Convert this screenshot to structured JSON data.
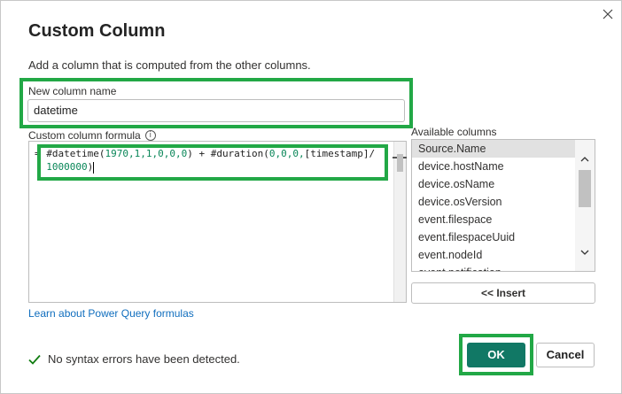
{
  "dialog": {
    "title": "Custom Column",
    "subtitle": "Add a column that is computed from the other columns."
  },
  "new_column": {
    "label": "New column name",
    "value": "datetime"
  },
  "formula": {
    "label": "Custom column formula",
    "prefix": "= ",
    "line1_a": "#datetime(",
    "line1_b": "1970,1,1,0,0,0",
    "line1_c": ") + #duration(",
    "line1_d": "0,0,0,",
    "line1_e": "[timestamp]/",
    "line2_a": "1000000",
    "line2_b": ")"
  },
  "available_columns": {
    "label": "Available columns",
    "items": [
      "Source.Name",
      "device.hostName",
      "device.osName",
      "device.osVersion",
      "event.filespace",
      "event.filespaceUuid",
      "event.nodeId",
      "event.notification"
    ],
    "selected_index": 0
  },
  "insert_button": "<< Insert",
  "learn_link": "Learn about Power Query formulas",
  "status_text": "No syntax errors have been detected.",
  "buttons": {
    "ok": "OK",
    "cancel": "Cancel"
  },
  "colors": {
    "highlight": "#22a846",
    "ok_button": "#117865",
    "link": "#106ebe",
    "status_check": "#107c10"
  }
}
